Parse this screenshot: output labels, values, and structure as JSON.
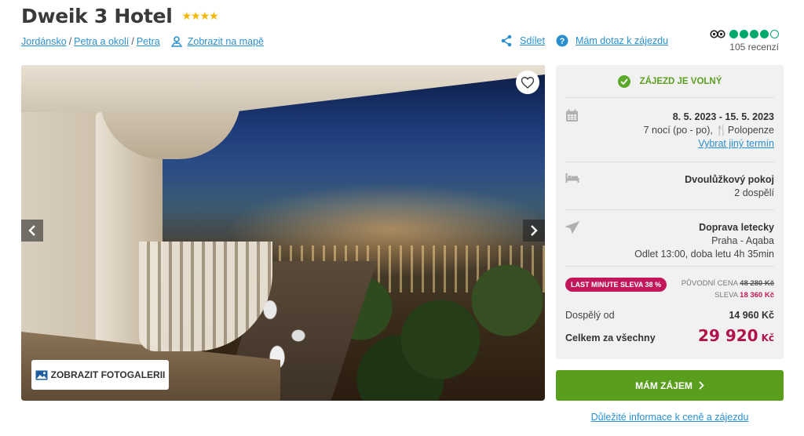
{
  "hotel": {
    "name": "Dweik 3 Hotel",
    "stars": "★★★★"
  },
  "breadcrumbs": [
    "Jordánsko",
    "Petra a okolí",
    "Petra"
  ],
  "map_link": "Zobrazit na mapě",
  "actions": {
    "share": "Sdílet",
    "question": "Mám dotaz k zájezdu"
  },
  "tripadvisor": {
    "rating_dots_filled": 4,
    "rating_dots_total": 5,
    "reviews": "105 recenzí"
  },
  "gallery": {
    "button_label": "ZOBRAZIT FOTOGALERII"
  },
  "panel": {
    "status": "ZÁJEZD JE VOLNÝ",
    "dates": "8. 5. 2023 - 15. 5. 2023",
    "nights": "7 nocí (po - po),",
    "board": "Polopenze",
    "change_date": "Vybrat jiný termín",
    "room": "Dvoulůžkový pokoj",
    "guests": "2 dospělí",
    "transport": "Doprava letecky",
    "route": "Praha - Aqaba",
    "departure": "Odlet 13:00, doba letu 4h 35min",
    "badge": "LAST MINUTE SLEVA 38 %",
    "orig_label": "PŮVODNÍ CENA",
    "orig_price": "48 280 Kč",
    "discount_label": "SLEVA",
    "discount": "18 360 Kč",
    "adult_label": "Dospělý od",
    "adult_price": "14 960 Kč",
    "total_label": "Celkem za všechny",
    "total_price": "29 920",
    "total_currency": "Kč"
  },
  "cta": "MÁM ZÁJEM",
  "info_link": "Důležité informace k ceně a zájezdu",
  "colors": {
    "accent_blue": "#2a8fd0",
    "green": "#5a9e1e",
    "price_red": "#b0124e",
    "tripadvisor": "#00aa6c"
  }
}
